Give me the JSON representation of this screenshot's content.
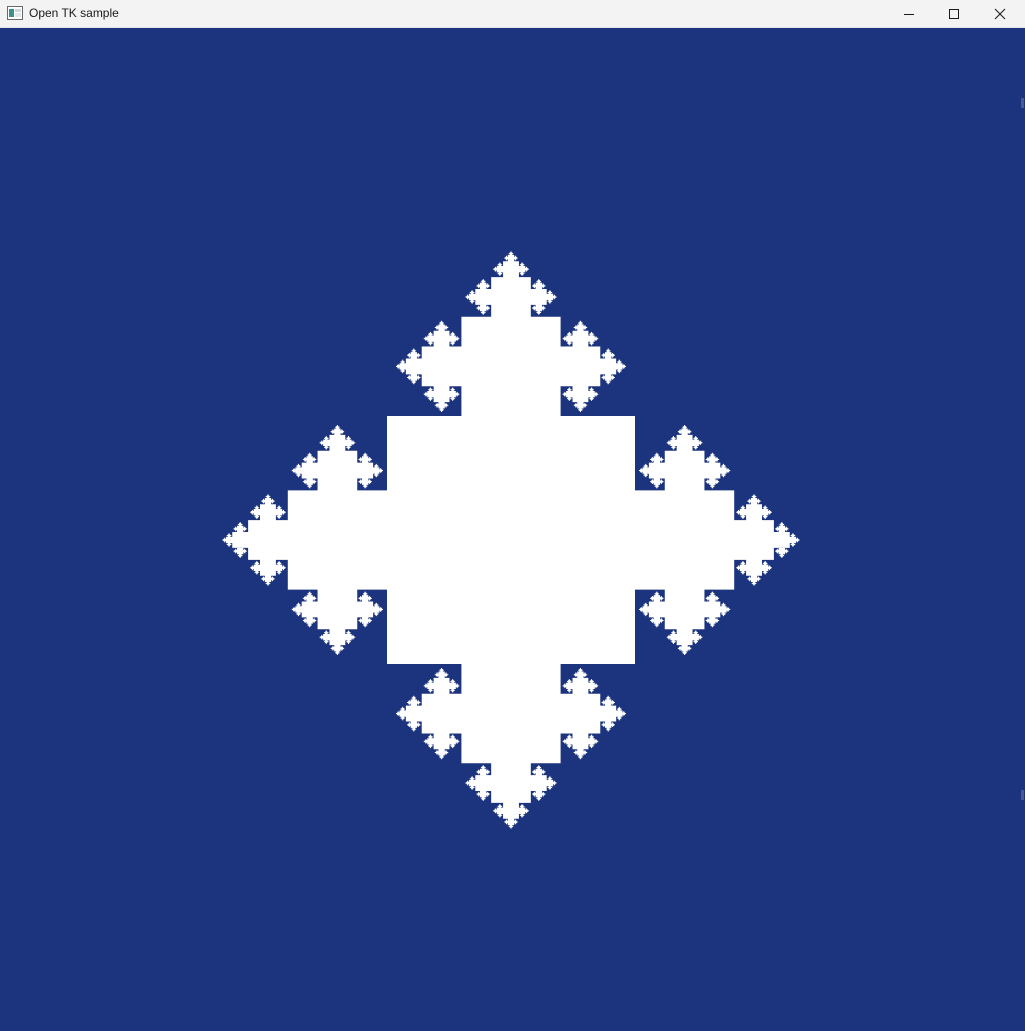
{
  "window": {
    "title": "Open TK sample",
    "app_icon": "window-app-icon",
    "controls": {
      "minimize_icon": "minimize-icon",
      "maximize_icon": "maximize-icon",
      "close_icon": "close-icon"
    }
  },
  "canvas": {
    "background_color": "#1c347e",
    "fill_color": "#ffffff",
    "shape": "quadratic Koch island fractal"
  }
}
